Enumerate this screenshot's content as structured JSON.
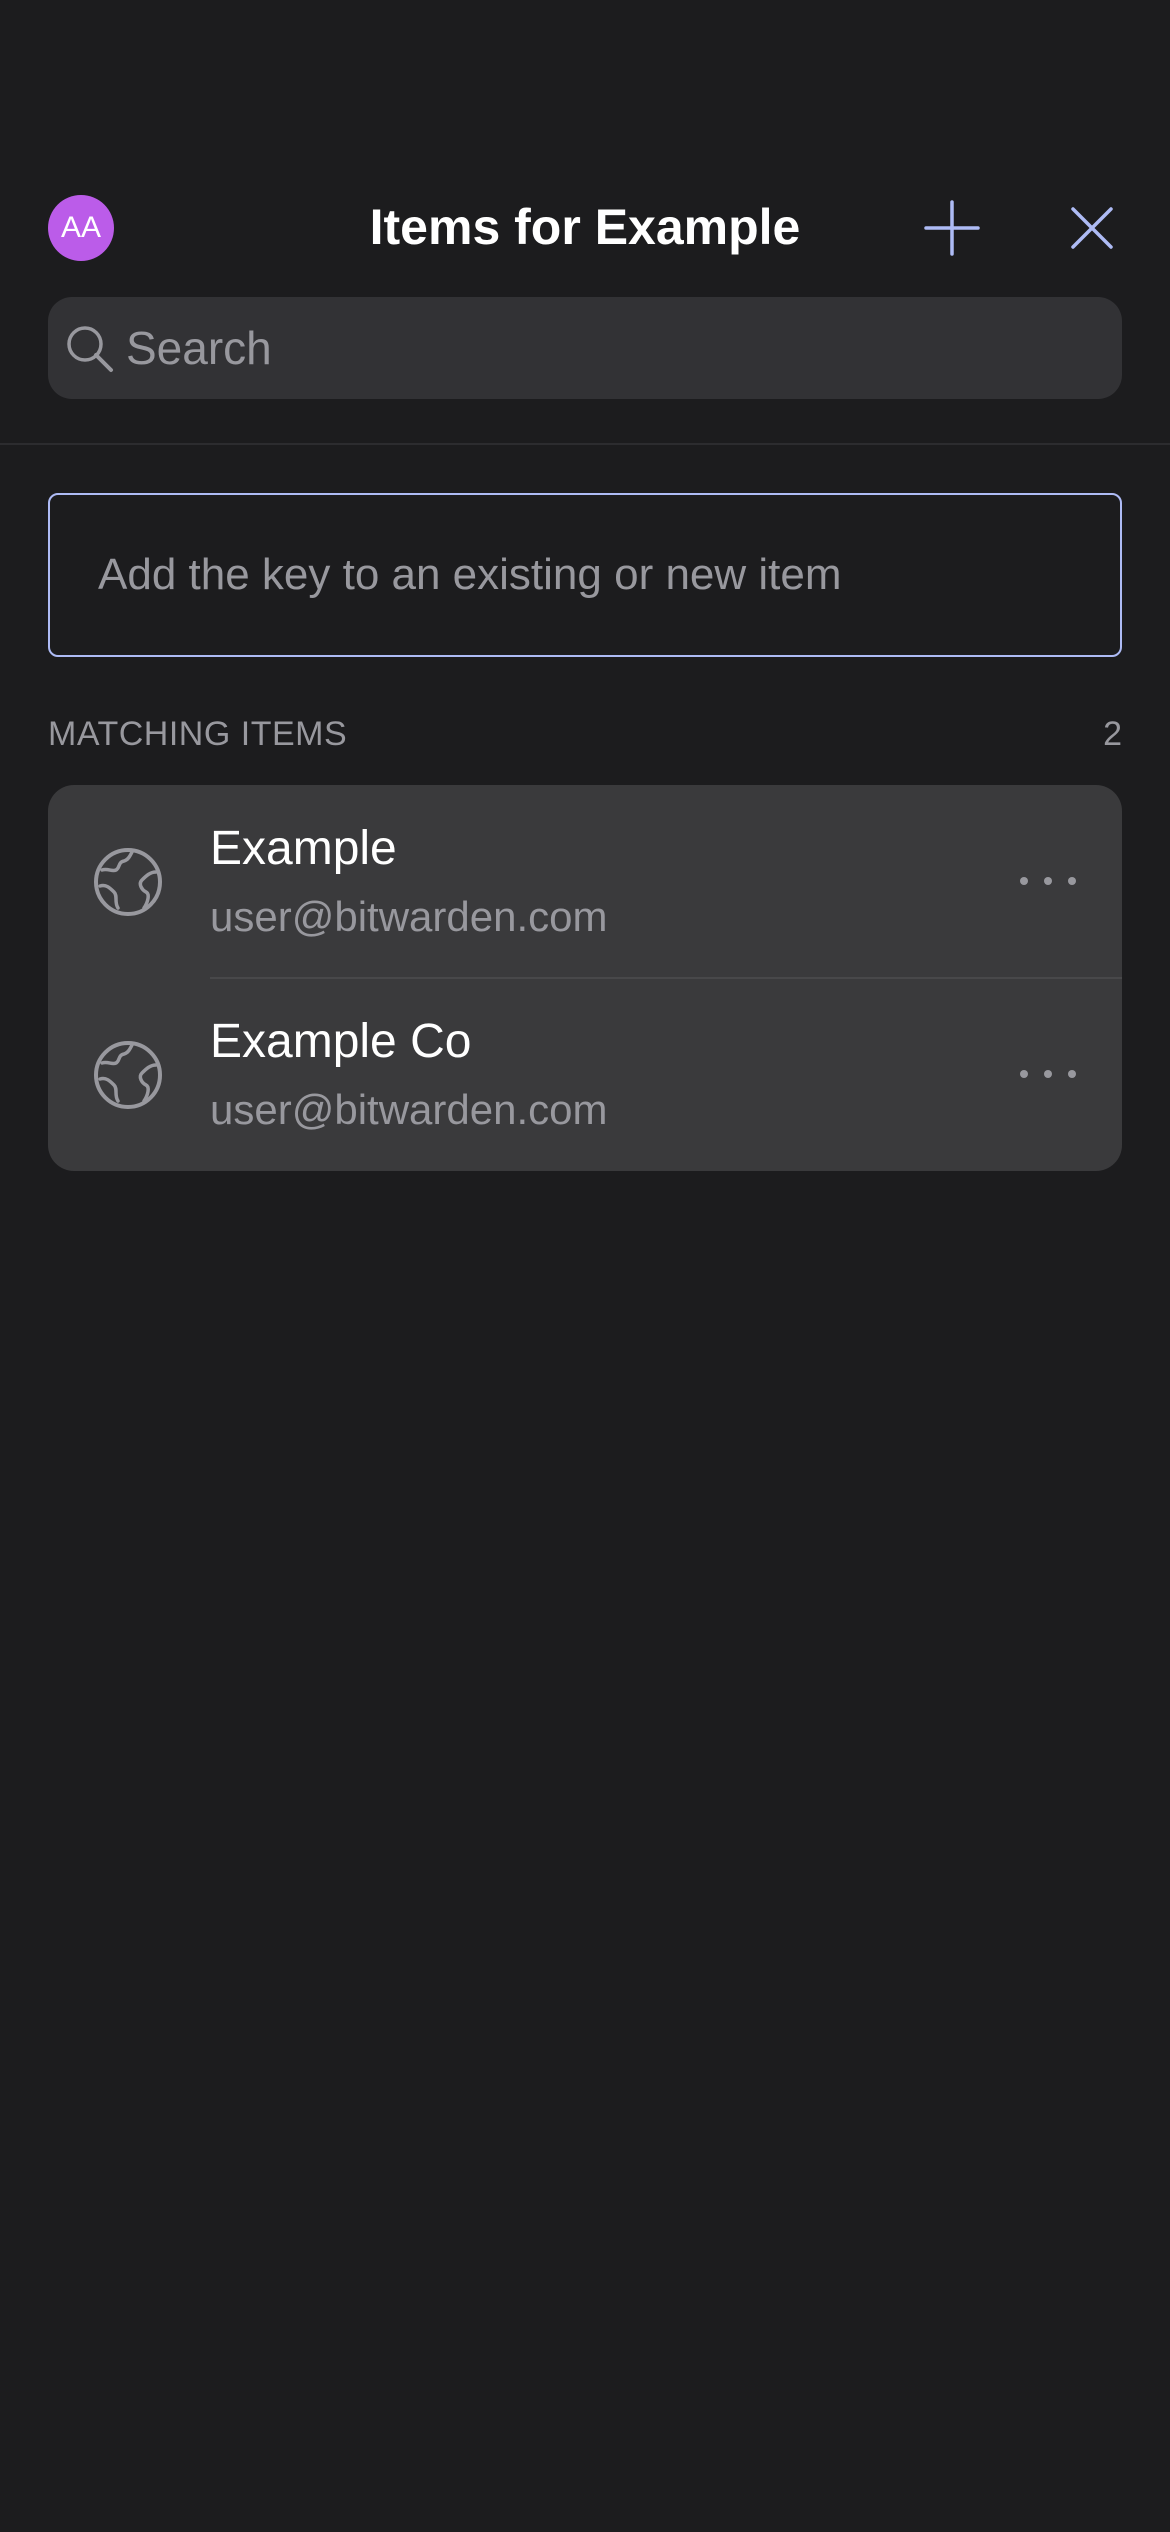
{
  "header": {
    "avatar_initials": "AA",
    "avatar_color": "#bb5ce9",
    "title": "Items for Example",
    "add_icon": "plus-icon",
    "close_icon": "close-icon",
    "accent_color": "#aebbf5"
  },
  "search": {
    "placeholder": "Search",
    "value": "",
    "icon": "search-icon"
  },
  "add_key": {
    "label": "Add the key to an existing or new item"
  },
  "matching": {
    "label": "MATCHING ITEMS",
    "count": "2",
    "items": [
      {
        "name": "Example",
        "username": "user@bitwarden.com",
        "icon": "globe-icon",
        "menu_icon": "more-icon"
      },
      {
        "name": "Example Co",
        "username": "user@bitwarden.com",
        "icon": "globe-icon",
        "menu_icon": "more-icon"
      }
    ]
  }
}
